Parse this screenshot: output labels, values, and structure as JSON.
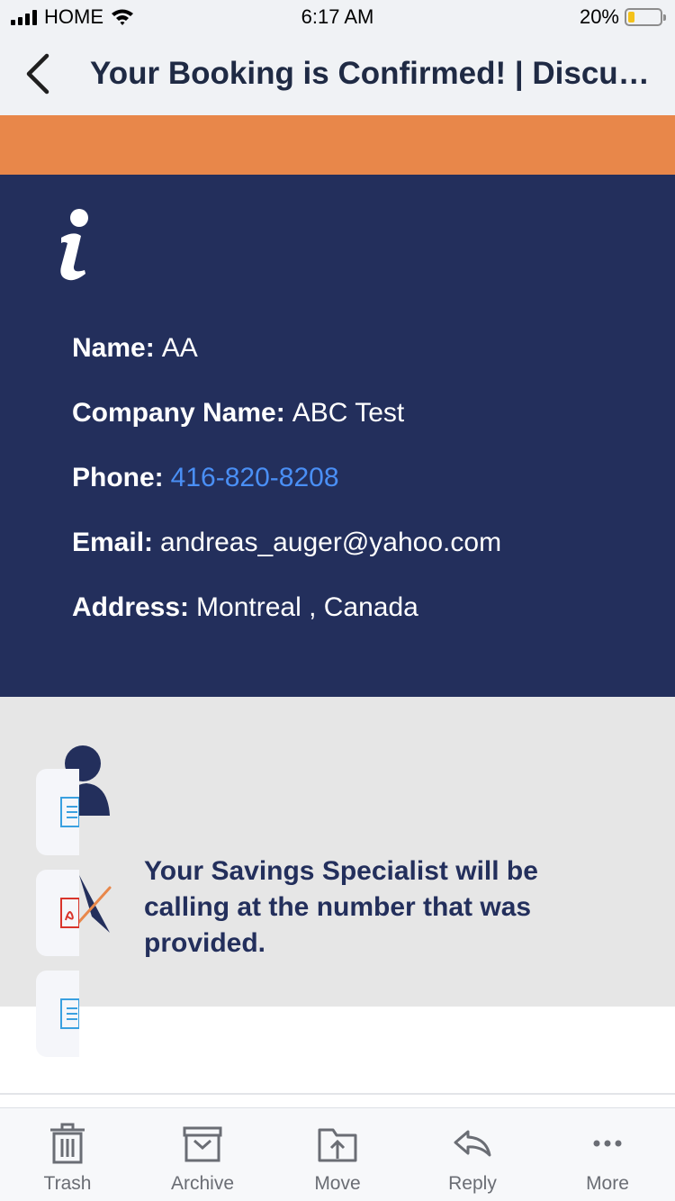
{
  "status_bar": {
    "carrier": "HOME",
    "time": "6:17 AM",
    "battery_percent": "20%",
    "battery_level": 0.2,
    "battery_color": "#f4c21b",
    "icons": [
      "signal-icon",
      "wifi-icon",
      "battery-icon"
    ]
  },
  "nav": {
    "back_icon": "chevron-left-icon",
    "title": "Your Booking is Confirmed! | Discussion with your Savings Specialist"
  },
  "colors": {
    "accent_orange": "#e8874a",
    "panel_navy": "#232f5c",
    "link_blue": "#4a8ff5",
    "gray_panel": "#e6e6e6"
  },
  "info": {
    "icon": "info-icon",
    "name_label": "Name:",
    "name_value": "AA",
    "company_label": "Company Name:",
    "company_value": "ABC Test",
    "phone_label": "Phone:",
    "phone_value": "416-820-8208",
    "email_label": "Email:",
    "email_value": "andreas_auger@yahoo.com",
    "address_label": "Address:",
    "address_value": "Montreal , Canada"
  },
  "specialist": {
    "icons": [
      "person-icon",
      "compass-icon"
    ],
    "message": "Your Savings Specialist will be calling at the number that was provided."
  },
  "attachments": [
    {
      "icon": "document-icon"
    },
    {
      "icon": "pdf-icon"
    },
    {
      "icon": "document-icon"
    }
  ],
  "toolbar": {
    "trash_label": "Trash",
    "archive_label": "Archive",
    "move_label": "Move",
    "reply_label": "Reply",
    "more_label": "More"
  }
}
